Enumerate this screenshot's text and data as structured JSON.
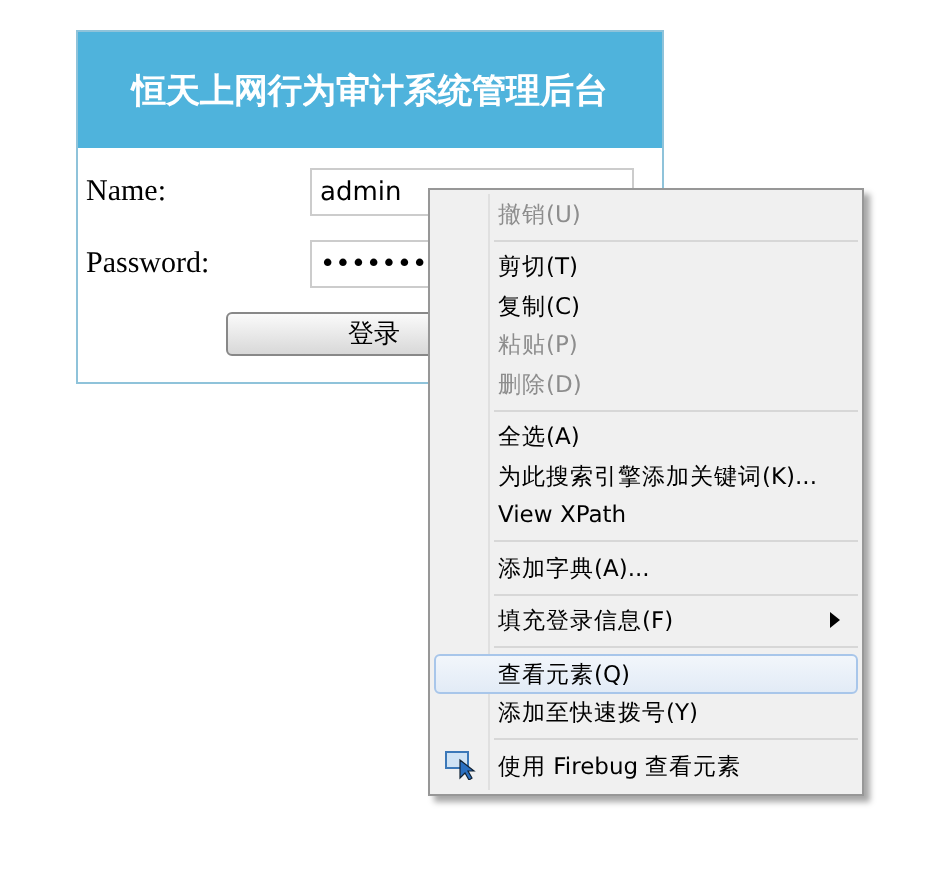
{
  "login": {
    "title": "恒天上网行为审计系统管理后台",
    "fields": [
      {
        "label": "Name:",
        "value": "admin"
      },
      {
        "label": "Password:",
        "value": "•••••••"
      }
    ],
    "submit": "登录"
  },
  "context_menu": {
    "items": [
      {
        "kind": "item",
        "label": "撤销(U)",
        "disabled": true,
        "selected": false
      },
      {
        "kind": "separator"
      },
      {
        "kind": "item",
        "label": "剪切(T)",
        "disabled": false,
        "selected": false
      },
      {
        "kind": "item",
        "label": "复制(C)",
        "disabled": false,
        "selected": false
      },
      {
        "kind": "item",
        "label": "粘贴(P)",
        "disabled": true,
        "selected": false
      },
      {
        "kind": "item",
        "label": "删除(D)",
        "disabled": true,
        "selected": false
      },
      {
        "kind": "separator"
      },
      {
        "kind": "item",
        "label": "全选(A)",
        "disabled": false,
        "selected": false
      },
      {
        "kind": "item",
        "label": "为此搜索引擎添加关键词(K)...",
        "disabled": false,
        "selected": false
      },
      {
        "kind": "item",
        "label": "View XPath",
        "disabled": false,
        "selected": false
      },
      {
        "kind": "separator"
      },
      {
        "kind": "item",
        "label": "添加字典(A)...",
        "disabled": false,
        "selected": false
      },
      {
        "kind": "separator"
      },
      {
        "kind": "submenu",
        "label": "填充登录信息(F)",
        "disabled": false,
        "selected": false
      },
      {
        "kind": "separator"
      },
      {
        "kind": "item",
        "label": "查看元素(Q)",
        "disabled": false,
        "selected": true
      },
      {
        "kind": "item",
        "label": "添加至快速拨号(Y)",
        "disabled": false,
        "selected": false
      },
      {
        "kind": "separator"
      },
      {
        "kind": "icon_item",
        "label": "使用 Firebug 查看元素",
        "disabled": false,
        "selected": false
      }
    ]
  }
}
